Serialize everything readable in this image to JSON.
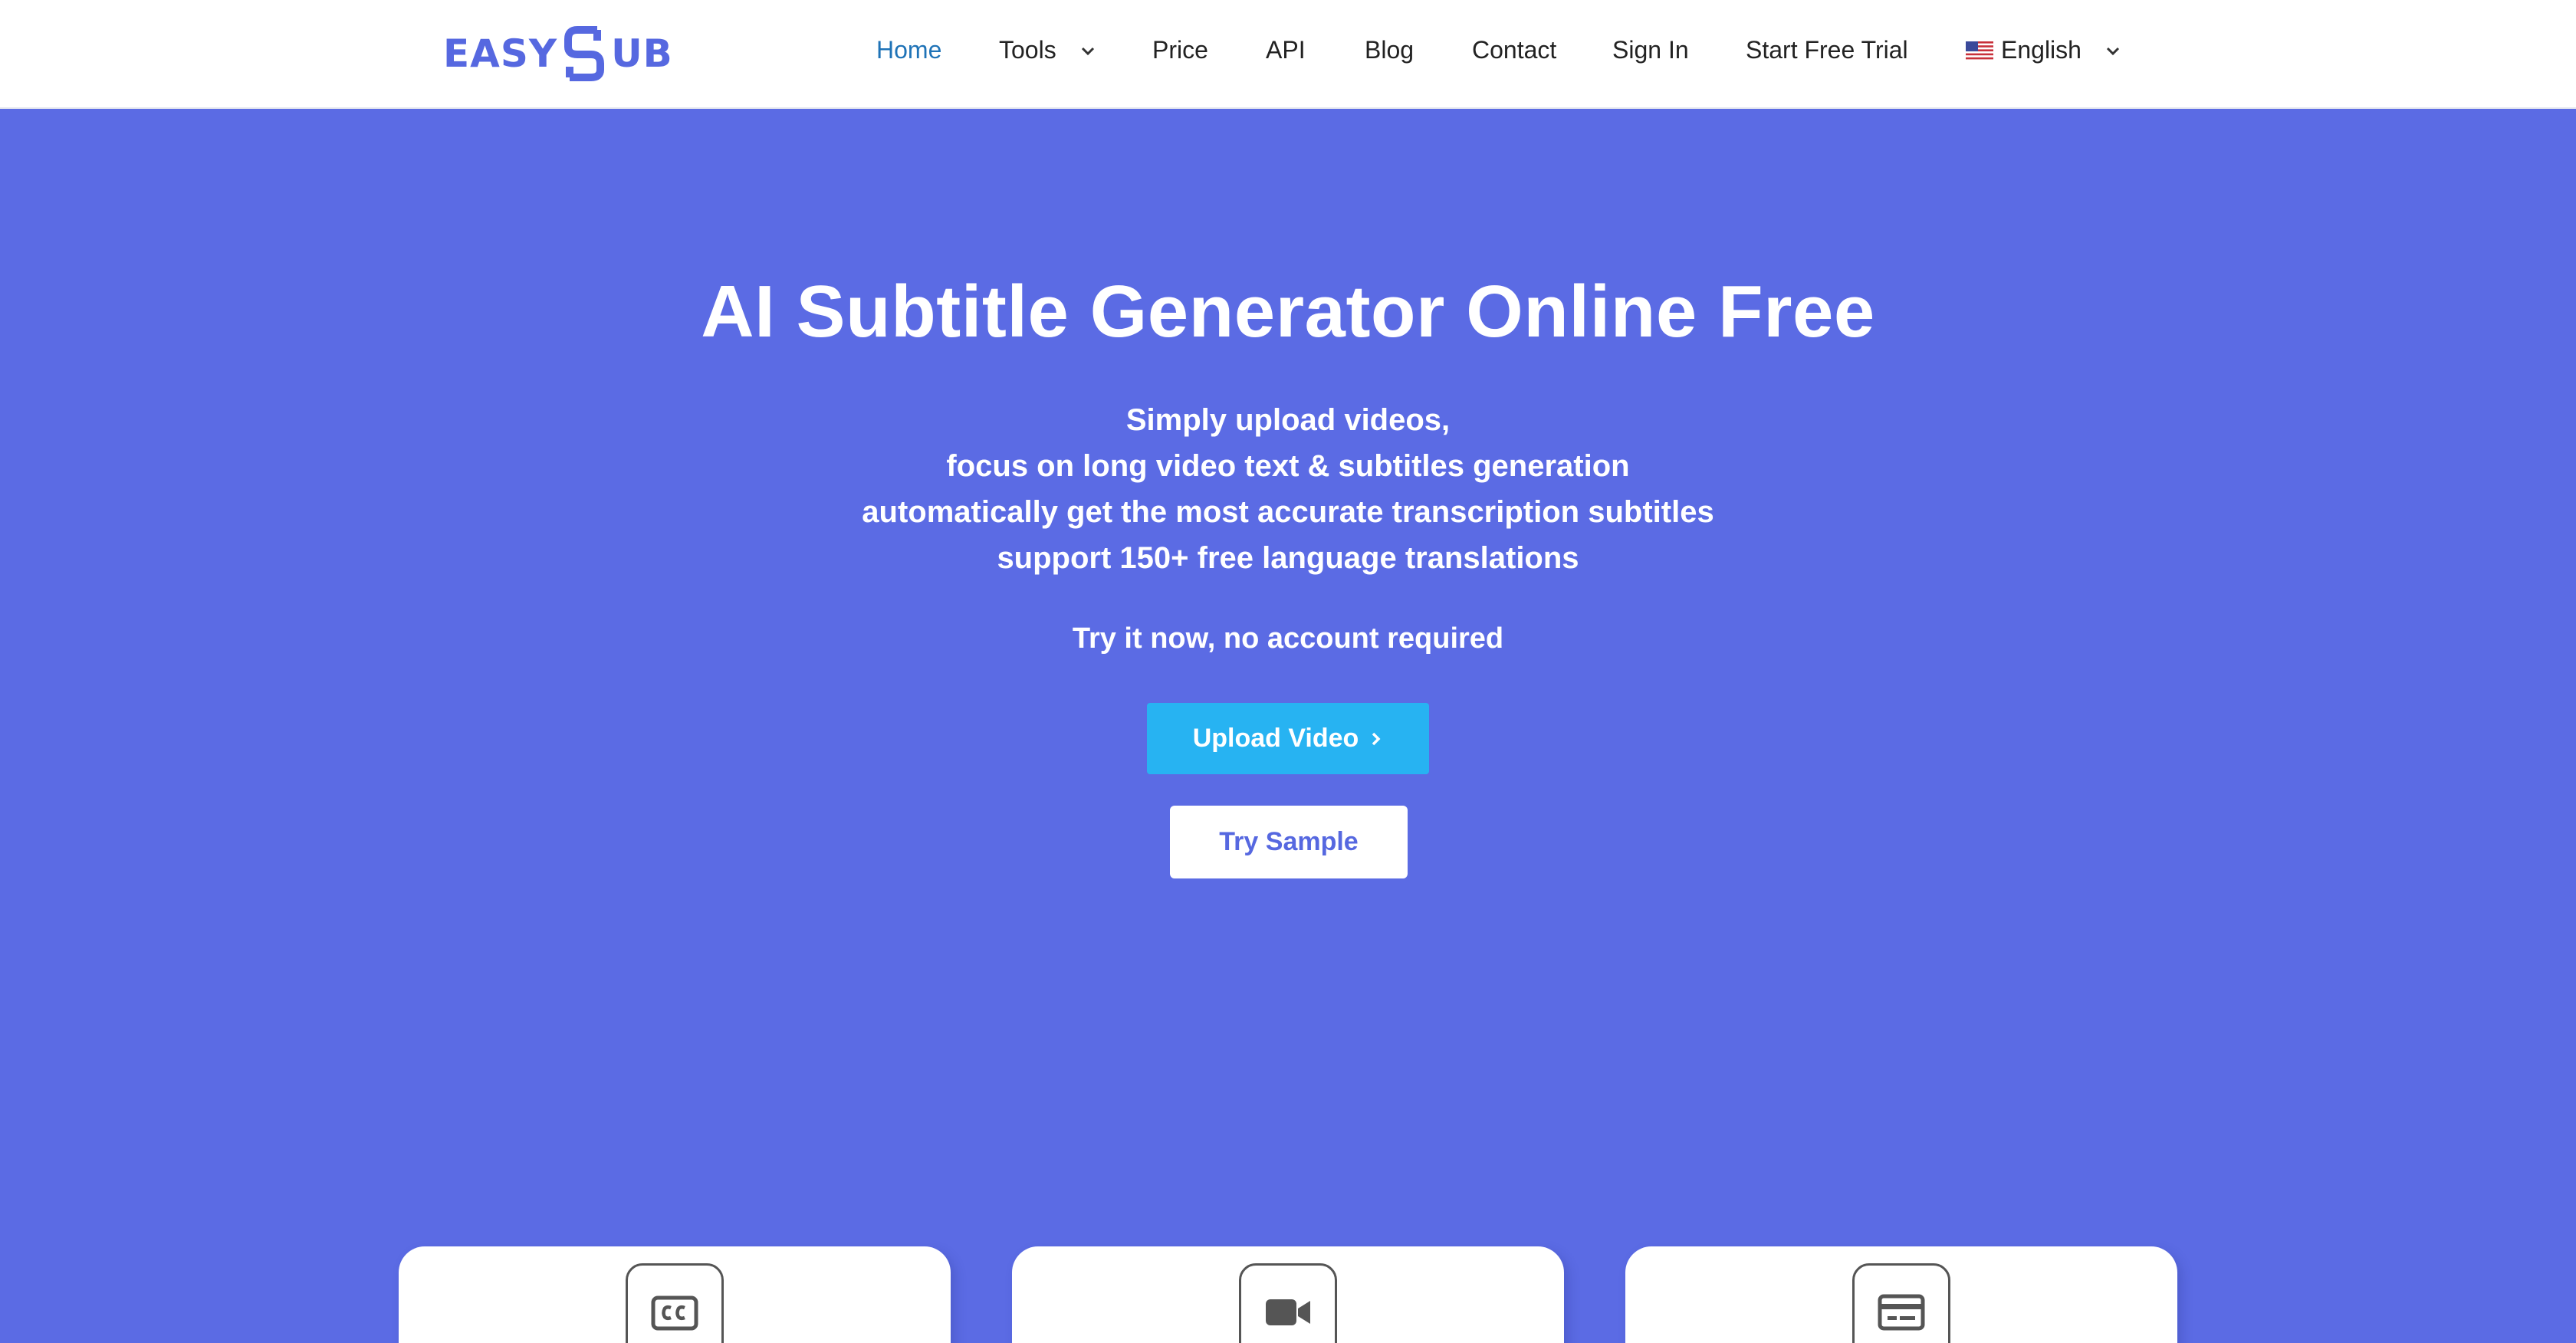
{
  "brand": {
    "logo_left": "EASY",
    "logo_right": "UB",
    "logo_color": "#5668E0"
  },
  "nav": {
    "items": [
      {
        "label": "Home",
        "active": true
      },
      {
        "label": "Tools",
        "dropdown": true
      },
      {
        "label": "Price"
      },
      {
        "label": "API"
      },
      {
        "label": "Blog"
      },
      {
        "label": "Contact"
      },
      {
        "label": "Sign In"
      },
      {
        "label": "Start Free Trial"
      }
    ],
    "language": {
      "label": "English",
      "icon": "us-flag-icon"
    }
  },
  "hero": {
    "title": "AI Subtitle Generator Online Free",
    "subtitle_lines": [
      "Simply upload videos,",
      "focus on long video text & subtitles generation",
      "automatically get the most accurate transcription subtitles",
      "support 150+ free language translations"
    ],
    "try_now": "Try it now, no account required",
    "upload_button": "Upload Video",
    "sample_button": "Try Sample"
  },
  "cards": [
    {
      "icon": "closed-caption-icon"
    },
    {
      "icon": "video-camera-icon"
    },
    {
      "icon": "subtitle-card-icon"
    }
  ],
  "colors": {
    "hero_background": "#5B6BE4",
    "upload_button": "#27B3F2",
    "active_nav": "#1F73B7",
    "header_background": "#ffffff"
  }
}
